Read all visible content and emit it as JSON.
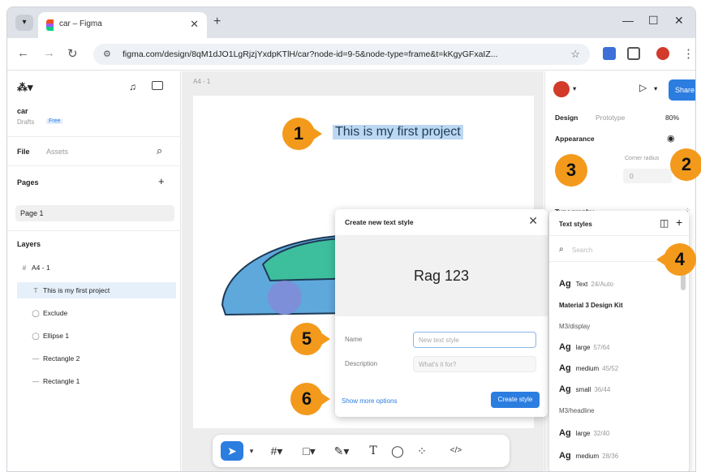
{
  "browser": {
    "tab_title": "car – Figma",
    "tab_close": "✕",
    "new_tab": "+",
    "url": "figma.com/design/8qM1dJO1LgRjzjYxdpKTlH/car?node-id=9-5&node-type=frame&t=kKgyGFxaIZ...",
    "win_min": "—",
    "win_max": "☐",
    "win_close": "✕"
  },
  "left_panel": {
    "file_name": "car",
    "drafts": "Drafts",
    "plan": "Free",
    "tab_file": "File",
    "tab_assets": "Assets",
    "pages_label": "Pages",
    "page_item": "Page 1",
    "layers_label": "Layers",
    "layers": [
      {
        "icon": "#",
        "label": "A4 - 1"
      },
      {
        "icon": "T",
        "label": "This is my first project"
      },
      {
        "icon": "◯",
        "label": "Exclude"
      },
      {
        "icon": "◯",
        "label": "Ellipse 1"
      },
      {
        "icon": "—",
        "label": "Rectangle 2"
      },
      {
        "icon": "—",
        "label": "Rectangle 1"
      }
    ]
  },
  "canvas": {
    "frame_label": "A4 - 1",
    "selected_text": "This is my first project"
  },
  "modal": {
    "title": "Create new text style",
    "close": "✕",
    "preview": "Rag 123",
    "name_label": "Name",
    "name_placeholder": "New text style",
    "description_label": "Description",
    "description_placeholder": "What's it for?",
    "more_options": "Show more options",
    "create_button": "Create style"
  },
  "right_panel": {
    "share": "Share",
    "tab_design": "Design",
    "tab_prototype": "Prototype",
    "zoom": "80%",
    "appearance": "Appearance",
    "corner_radius": "Corner radius",
    "corner_value": "0",
    "typography": "Typography"
  },
  "text_styles": {
    "title": "Text styles",
    "search_placeholder": "Search",
    "items": [
      {
        "kind": "style",
        "ag": "Ag",
        "name": "Text",
        "meta": "24/Auto"
      },
      {
        "kind": "header",
        "name": "Material 3 Design Kit"
      },
      {
        "kind": "subheader",
        "name": "M3/display"
      },
      {
        "kind": "style",
        "ag": "Ag",
        "name": "large",
        "meta": "57/64"
      },
      {
        "kind": "style",
        "ag": "Ag",
        "name": "medium",
        "meta": "45/52"
      },
      {
        "kind": "style",
        "ag": "Ag",
        "name": "small",
        "meta": "36/44"
      },
      {
        "kind": "subheader",
        "name": "M3/headline"
      },
      {
        "kind": "style",
        "ag": "Ag",
        "name": "large",
        "meta": "32/40"
      },
      {
        "kind": "style",
        "ag": "Ag",
        "name": "medium",
        "meta": "28/36"
      }
    ]
  },
  "callouts": [
    "1",
    "2",
    "3",
    "4",
    "5",
    "6"
  ],
  "colors": {
    "accent": "#2b7de0",
    "callout": "#f39a1c",
    "selection": "#bcd7f2"
  }
}
